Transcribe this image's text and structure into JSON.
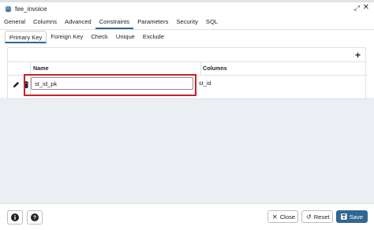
{
  "window": {
    "title": "fee_invoice"
  },
  "main_tabs": [
    "General",
    "Columns",
    "Advanced",
    "Constraints",
    "Parameters",
    "Security",
    "SQL"
  ],
  "sub_tabs": [
    "Primary Key",
    "Foreign Key",
    "Check",
    "Unique",
    "Exclude"
  ],
  "grid": {
    "headers": {
      "name": "Name",
      "columns": "Columns"
    },
    "rows": [
      {
        "name": "st_id_pk",
        "columns": "st_id"
      }
    ]
  },
  "footer": {
    "close_label": "Close",
    "reset_label": "Reset",
    "save_label": "Save"
  },
  "colors": {
    "accent": "#326690",
    "highlight": "#c8222c"
  },
  "icons": [
    "database-icon",
    "expand-icon",
    "close-icon",
    "add-icon",
    "edit-icon",
    "trash-icon",
    "info-icon",
    "help-icon",
    "close-x-icon",
    "reset-icon",
    "save-icon"
  ]
}
